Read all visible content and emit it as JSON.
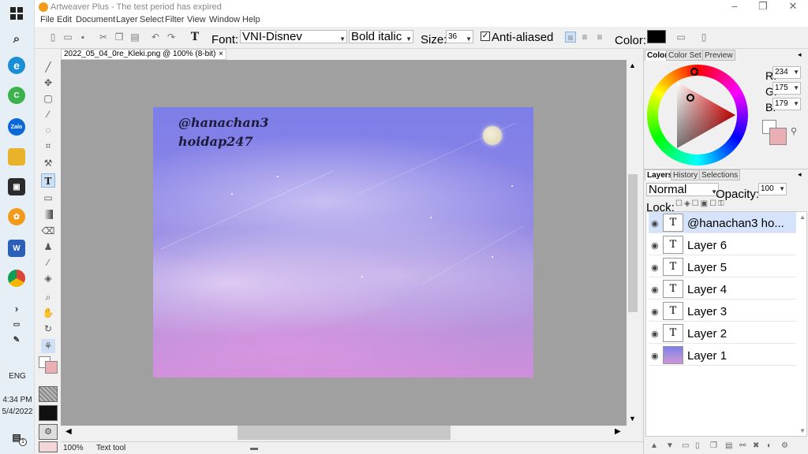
{
  "taskbar": {
    "time": "4:34 PM",
    "date": "5/4/2022",
    "lang": "ENG",
    "notif_count": "1",
    "zalo_label": "Zalo"
  },
  "app": {
    "title": "Artweaver Plus - The test period has expired"
  },
  "menu": [
    "File",
    "Edit",
    "Document",
    "Layer",
    "Select",
    "Filter",
    "View",
    "Window",
    "Help"
  ],
  "toolbar": {
    "font_label": "Font:",
    "font_value": "VNI-Disnev",
    "style_value": "Bold italic",
    "size_label": "Size:",
    "size_value": "36",
    "antialias_label": "Anti-aliased",
    "antialias_checked": true,
    "color_label": "Color:",
    "color_value": "#000000"
  },
  "document": {
    "tab_title": "2022_05_04_0re_Kleki.png @ 100% (8-bit)",
    "close": "×"
  },
  "artwork": {
    "text_line1": "@hanachan3",
    "text_line2": "hoidap247"
  },
  "status": {
    "zoom": "100%",
    "tool": "Text tool"
  },
  "color_panel": {
    "tabs": [
      "Color",
      "Color Set",
      "Preview"
    ],
    "r_label": "R:",
    "r": "234",
    "g_label": "G:",
    "g": "175",
    "b_label": "B:",
    "b": "179",
    "fg_color": "#ffffff",
    "bg_color": "#eaafb3"
  },
  "layers_panel": {
    "tabs": [
      "Layers",
      "History",
      "Selections"
    ],
    "blend_mode": "Normal",
    "opacity_label": "Opacity:",
    "opacity": "100",
    "lock_label": "Lock:",
    "layers": [
      {
        "name": "@hanachan3 ho...",
        "type": "T"
      },
      {
        "name": "Layer 6",
        "type": "T"
      },
      {
        "name": "Layer 5",
        "type": "T"
      },
      {
        "name": "Layer 4",
        "type": "T"
      },
      {
        "name": "Layer 3",
        "type": "T"
      },
      {
        "name": "Layer 2",
        "type": "T"
      },
      {
        "name": "Layer 1",
        "type": "image"
      }
    ]
  }
}
